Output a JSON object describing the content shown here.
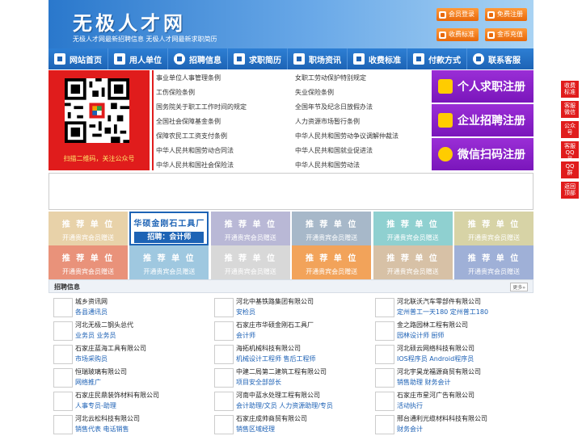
{
  "header": {
    "title": "无极人才网",
    "subtitle": "无极人才网最新招聘信息 无极人才网最新求职简历",
    "buttons": [
      "会员登录",
      "免费注册",
      "收费标准",
      "金币充值"
    ]
  },
  "nav": [
    "网站首页",
    "用人单位",
    "招聘信息",
    "求职简历",
    "职场资讯",
    "收费标准",
    "付款方式",
    "联系客服"
  ],
  "qr": {
    "caption": "扫描二维码，关注公众号"
  },
  "laws": [
    [
      "事业单位人事管理条例",
      "女职工劳动保护特别规定"
    ],
    [
      "工伤保险条例",
      "失业保险条例"
    ],
    [
      "国务院关于职工工作时间的规定",
      "全国年节及纪念日放假办法"
    ],
    [
      "全国社会保障基金条例",
      "人力资源市场暂行条例"
    ],
    [
      "保障农民工工资支付条例",
      "中华人民共和国劳动争议调解仲裁法"
    ],
    [
      "中华人民共和国劳动合同法",
      "中华人民共和国就业促进法"
    ],
    [
      "中华人民共和国社会保险法",
      "中华人民共和国劳动法"
    ]
  ],
  "register": [
    "个人求职注册",
    "企业招聘注册",
    "微信扫码注册"
  ],
  "recommend": {
    "t1": "推 荐 单 位",
    "t2": "开通贵宾会员赠送",
    "company_name": "华硕金刚石工具厂",
    "company_job": "招聘：会计师",
    "colors_row1": [
      "#e8d2a9",
      "company",
      "#b9b8d6",
      "#a7b8c9",
      "#8fd0d0",
      "#d7d3a6"
    ],
    "colors_row2": [
      "#e9927a",
      "#9fc8e0",
      "#d8d8d8",
      "#f2a35a",
      "#d7c1a6",
      "#9fb0d7"
    ]
  },
  "jobs_title": "招聘信息",
  "jobs_more": "更多»",
  "jobs": [
    [
      {
        "c": "城乡资讯网",
        "p": "各县通讯员"
      },
      {
        "c": "河北中基铁路集团有限公司",
        "p": "安检员"
      },
      {
        "c": "河北联沃汽车零部件有限公司",
        "p": "定州普工一天180 定州普工180"
      }
    ],
    [
      {
        "c": "河北无极二钢头总代",
        "p": "业务员 业务员"
      },
      {
        "c": "石家庄市华硕金刚石工具厂",
        "p": "会计师"
      },
      {
        "c": "金之路园林工程有限公司",
        "p": "园林设计师 厨师"
      }
    ],
    [
      {
        "c": "石家庄蓝海工具有限公司",
        "p": "市场采购员"
      },
      {
        "c": "海拓机械科技有限公司",
        "p": "机械设计工程师 售后工程师"
      },
      {
        "c": "河北硕云网络科技有限公司",
        "p": "IOS程序员 Android程序员"
      }
    ],
    [
      {
        "c": "恒瑞玻璃有限公司",
        "p": "网络推广"
      },
      {
        "c": "中建二局第二建筑工程有限公司",
        "p": "项目安全部部长"
      },
      {
        "c": "河北宇昊龙福源商贸有限公司",
        "p": "销售助理 财务会计"
      }
    ],
    [
      {
        "c": "石家庄民鼎装饰材料有限公司",
        "p": "人事专员-助理"
      },
      {
        "c": "河南中蓝水处理工程有限公司",
        "p": "会计助理/文员 人力资源助理/专员"
      },
      {
        "c": "石家庄市星河广告有限公司",
        "p": "活动执行"
      }
    ],
    [
      {
        "c": "河北云松科技有限公司",
        "p": "销售代表 电话销售"
      },
      {
        "c": "石家庄成帅商贸有限公司",
        "p": "销售区域经理"
      },
      {
        "c": "邢台通利光缆材料科技有限公司",
        "p": "财务会计"
      }
    ]
  ],
  "floatbar": [
    "收费标准",
    "客服微信",
    "公众号",
    "客服QQ号",
    "QQ群",
    "返回顶部"
  ]
}
